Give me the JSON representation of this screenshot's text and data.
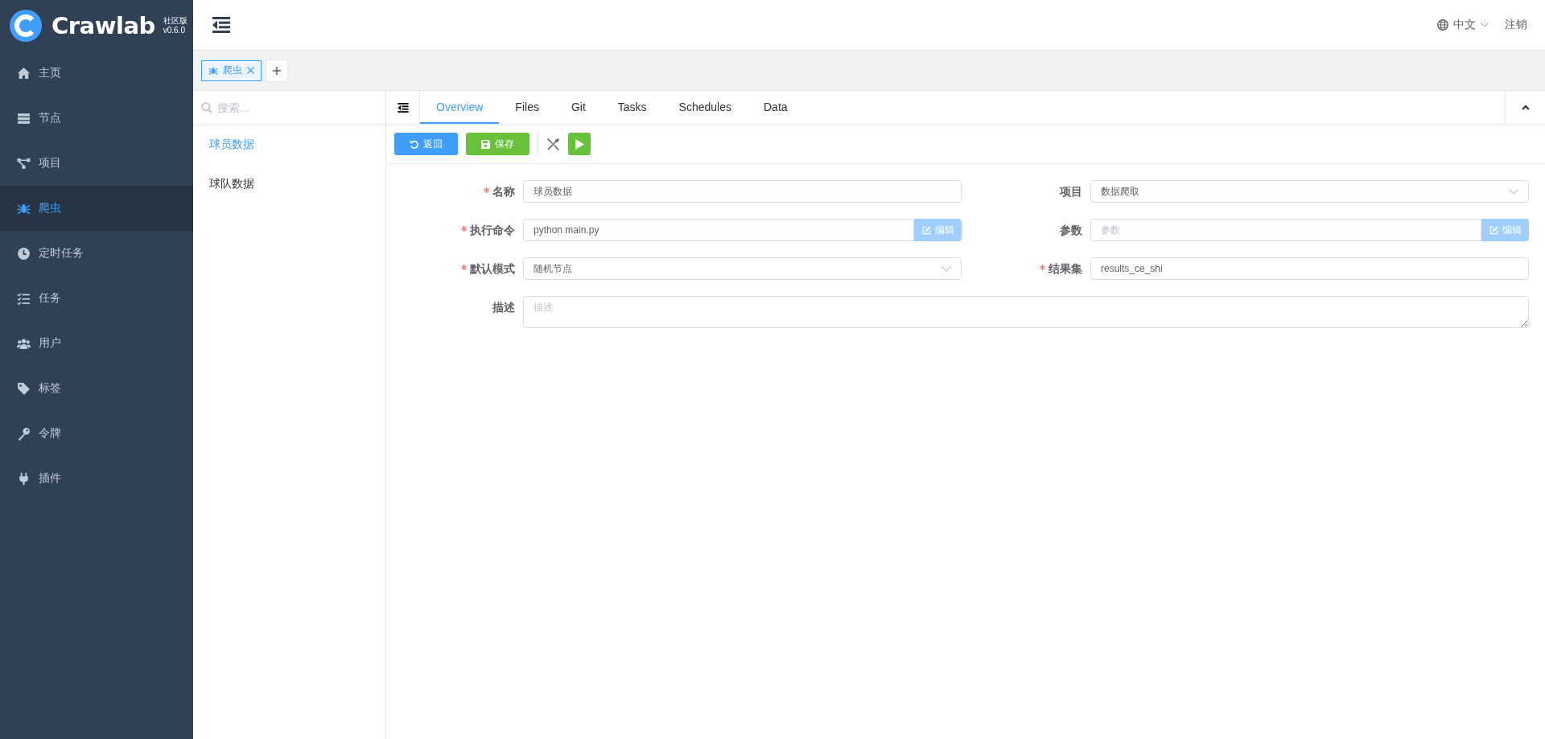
{
  "logo": {
    "name": "Crawlab",
    "edition": "社区版",
    "version": "v0.6.0"
  },
  "sidebar": {
    "items": [
      {
        "label": "主页",
        "kind": "home",
        "selected": false
      },
      {
        "label": "节点",
        "kind": "server",
        "selected": false
      },
      {
        "label": "项目",
        "kind": "project",
        "selected": false
      },
      {
        "label": "爬虫",
        "kind": "spider",
        "selected": true
      },
      {
        "label": "定时任务",
        "kind": "clock",
        "selected": false
      },
      {
        "label": "任务",
        "kind": "tasks",
        "selected": false
      },
      {
        "label": "用户",
        "kind": "users",
        "selected": false
      },
      {
        "label": "标签",
        "kind": "tag",
        "selected": false
      },
      {
        "label": "令牌",
        "kind": "key",
        "selected": false
      },
      {
        "label": "插件",
        "kind": "plug",
        "selected": false
      }
    ]
  },
  "header": {
    "language": "中文",
    "logout": "注销"
  },
  "open_tabs": [
    {
      "label": "爬虫",
      "selected": true
    }
  ],
  "spider_list": {
    "search_placeholder": "搜索...",
    "items": [
      {
        "label": "球员数据",
        "selected": true
      },
      {
        "label": "球队数据",
        "selected": false
      }
    ]
  },
  "detail_tabs": [
    {
      "label": "Overview",
      "selected": true
    },
    {
      "label": "Files",
      "selected": false
    },
    {
      "label": "Git",
      "selected": false
    },
    {
      "label": "Tasks",
      "selected": false
    },
    {
      "label": "Schedules",
      "selected": false
    },
    {
      "label": "Data",
      "selected": false
    }
  ],
  "toolbar": [
    {
      "kind": "back",
      "label": "返回"
    },
    {
      "kind": "save",
      "label": "保存"
    },
    {
      "kind": "tools"
    },
    {
      "kind": "run"
    }
  ],
  "form": {
    "fields": [
      {
        "label": "名称",
        "required": true,
        "kind": "text",
        "value": "球员数据"
      },
      {
        "label": "项目",
        "required": false,
        "kind": "select",
        "value": "数据爬取"
      },
      {
        "label": "执行命令",
        "required": true,
        "kind": "text-button",
        "value": "python main.py",
        "button": "编辑",
        "disabled": true
      },
      {
        "label": "参数",
        "required": false,
        "kind": "text-button",
        "placeholder": "参数",
        "button": "编辑",
        "disabled": true
      },
      {
        "label": "默认模式",
        "required": true,
        "kind": "select",
        "value": "随机节点"
      },
      {
        "label": "结果集",
        "required": true,
        "kind": "text",
        "value": "results_ce_shi"
      },
      {
        "label": "描述",
        "required": false,
        "kind": "textarea",
        "placeholder": "描述"
      }
    ]
  }
}
